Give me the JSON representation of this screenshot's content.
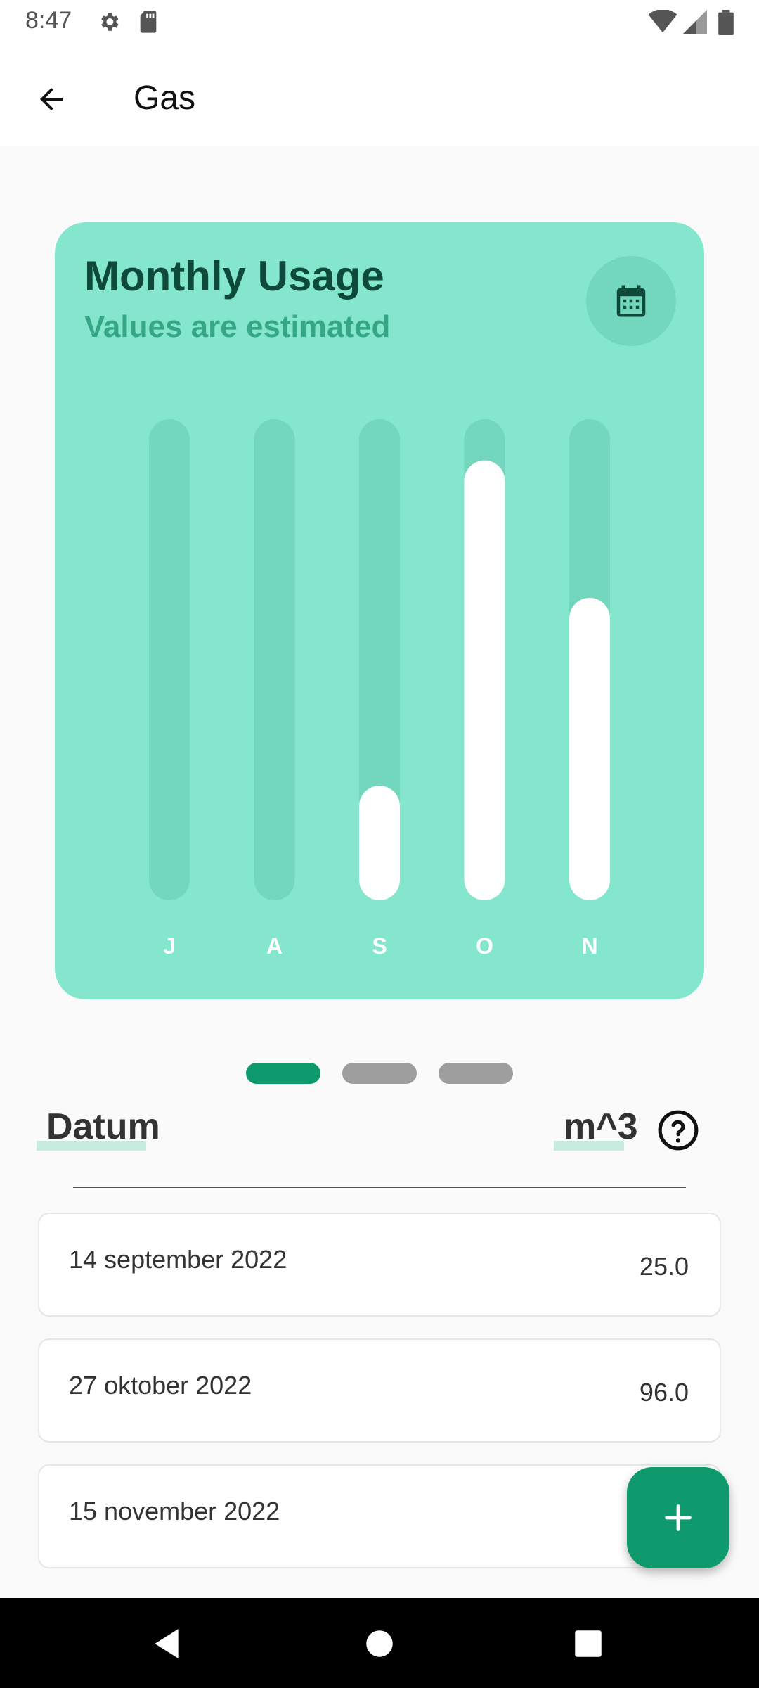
{
  "status_bar": {
    "time": "8:47",
    "icons": [
      "gear-icon",
      "sd-card-icon",
      "wifi-icon",
      "signal-icon",
      "battery-icon"
    ]
  },
  "app_bar": {
    "title": "Gas",
    "back_icon": "arrow-left-icon"
  },
  "card": {
    "title": "Monthly Usage",
    "subtitle": "Values are estimated",
    "calendar_icon": "calendar-icon",
    "colors": {
      "background": "#84e6cc",
      "track": "#72d7bd",
      "bar": "#ffffff",
      "title": "#0e4a3a",
      "subtitle": "#36a785"
    }
  },
  "chart_data": {
    "type": "bar",
    "categories": [
      "J",
      "A",
      "S",
      "O",
      "N"
    ],
    "values": [
      0,
      0,
      25.0,
      96.0,
      66
    ],
    "ylim": [
      0,
      105
    ],
    "grid": false,
    "title": "Monthly Usage",
    "subtitle": "Values are estimated"
  },
  "pager": {
    "pages": 3,
    "active_index": 0,
    "colors": {
      "active": "#0e9a6c",
      "inactive": "#9e9e9e"
    }
  },
  "table": {
    "header_date": "Datum",
    "header_unit": "m^3",
    "help_icon": "help-circle-icon",
    "rows": [
      {
        "date": "14 september 2022",
        "value": "25.0"
      },
      {
        "date": "27 oktober 2022",
        "value": "96.0"
      },
      {
        "date": "15 november 2022",
        "value": ""
      }
    ]
  },
  "fab": {
    "icon": "plus-icon",
    "color": "#0e9a6c"
  },
  "nav_bar": {
    "icons": [
      "nav-back-icon",
      "nav-home-icon",
      "nav-recents-icon"
    ]
  }
}
